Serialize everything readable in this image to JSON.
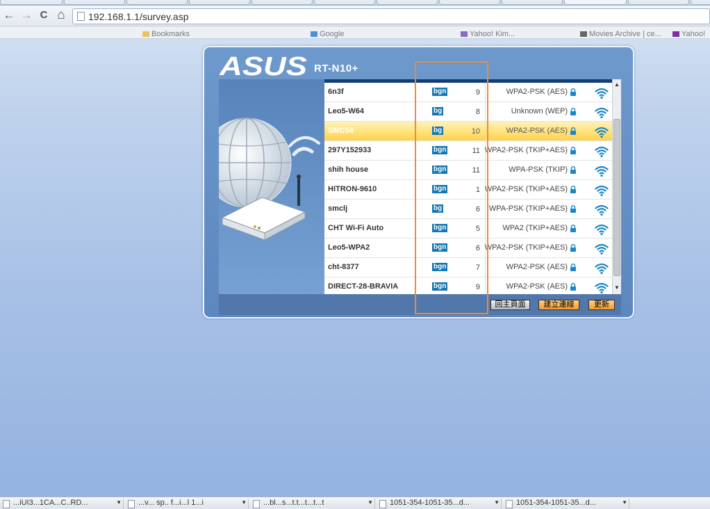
{
  "browser": {
    "url": "192.168.1.1/survey.asp",
    "back_glyph": "←",
    "forward_glyph": "→",
    "reload_glyph": "C",
    "home_glyph": "⌂",
    "bookmarks": [
      "Bookmarks",
      "Google",
      "Yahoo! Kim...",
      "Movies Archive | ce...",
      "Yahoo!"
    ]
  },
  "router": {
    "brand": "ASUS",
    "model": "RT-N10+",
    "networks": [
      {
        "ssid": "6n3f",
        "mode": "bgn",
        "channel": "9",
        "encryption": "WPA2-PSK (AES)",
        "selected": false
      },
      {
        "ssid": "Leo5-W64",
        "mode": "bg",
        "channel": "8",
        "encryption": "Unknown (WEP)",
        "selected": false
      },
      {
        "ssid": "SMC54",
        "mode": "bg",
        "channel": "10",
        "encryption": "WPA2-PSK (AES)",
        "selected": true
      },
      {
        "ssid": "297Y152933",
        "mode": "bgn",
        "channel": "11",
        "encryption": "WPA2-PSK (TKIP+AES)",
        "selected": false
      },
      {
        "ssid": "shih house",
        "mode": "bgn",
        "channel": "11",
        "encryption": "WPA-PSK (TKIP)",
        "selected": false
      },
      {
        "ssid": "HITRON-9610",
        "mode": "bgn",
        "channel": "1",
        "encryption": "WPA2-PSK (TKIP+AES)",
        "selected": false
      },
      {
        "ssid": "smclj",
        "mode": "bg",
        "channel": "6",
        "encryption": "WPA-PSK (TKIP+AES)",
        "selected": false
      },
      {
        "ssid": "CHT Wi-Fi Auto",
        "mode": "bgn",
        "channel": "5",
        "encryption": "WPA2 (TKIP+AES)",
        "selected": false
      },
      {
        "ssid": "Leo5-WPA2",
        "mode": "bgn",
        "channel": "6",
        "encryption": "WPA2-PSK (TKIP+AES)",
        "selected": false
      },
      {
        "ssid": "cht-8377",
        "mode": "bgn",
        "channel": "7",
        "encryption": "WPA2-PSK (AES)",
        "selected": false
      },
      {
        "ssid": "DIRECT-28-BRAVIA",
        "mode": "bgn",
        "channel": "9",
        "encryption": "WPA2-PSK (AES)",
        "selected": false
      }
    ],
    "buttons": {
      "home": "回主頁面",
      "connect": "建立連線",
      "refresh": "更新"
    }
  },
  "taskbar": {
    "downloads": [
      "...iUI3...1CA...C..RD...",
      "...v... sp.. f...i...l 1...i",
      "...bl...s...t.t...t...t...t",
      "1051-354-1051-35...d...",
      "1051-354-1051-35...d..."
    ]
  },
  "colors": {
    "accent_orange": "#f0883a",
    "mode_badge": "#1577b2",
    "header_bar": "#123e74",
    "selected_row": "#ffe27a",
    "wifi_icon": "#1886c8"
  }
}
